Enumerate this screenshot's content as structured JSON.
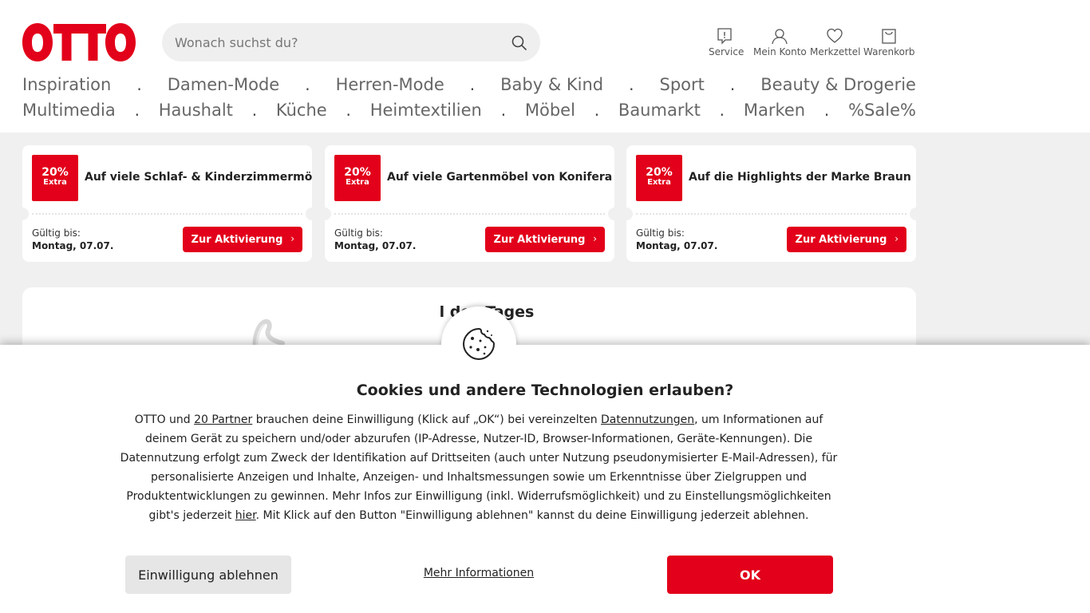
{
  "brand": {
    "logo_text": "OTTO",
    "accent_color": "#e2001a"
  },
  "search": {
    "placeholder": "Wonach suchst du?",
    "icon": "search-icon"
  },
  "header_tools": [
    {
      "label": "Service",
      "icon": "service-icon"
    },
    {
      "label": "Mein Konto",
      "icon": "user-icon"
    },
    {
      "label": "Merkzettel",
      "icon": "heart-icon"
    },
    {
      "label": "Warenkorb",
      "icon": "cart-icon"
    }
  ],
  "nav": {
    "separator": ".",
    "row1": [
      "Inspiration",
      "Damen-Mode",
      "Herren-Mode",
      "Baby & Kind",
      "Sport",
      "Beauty & Drogerie"
    ],
    "row2": [
      "Multimedia",
      "Haushalt",
      "Küche",
      "Heimtextilien",
      "Möbel",
      "Baumarkt",
      "Marken",
      "%Sale%"
    ]
  },
  "coupons": [
    {
      "badge_pct": "20%",
      "badge_extra": "Extra",
      "title": "Auf viele Schlaf- & Kinderzimmermöbel",
      "valid_label": "Gültig bis:",
      "valid_date": "Montag, 07.07.",
      "button": "Zur Aktivierung"
    },
    {
      "badge_pct": "20%",
      "badge_extra": "Extra",
      "title": "Auf viele Gartenmöbel von Konifera",
      "valid_label": "Gültig bis:",
      "valid_date": "Montag, 07.07.",
      "button": "Zur Aktivierung"
    },
    {
      "badge_pct": "20%",
      "badge_extra": "Extra",
      "title": "Auf die Highlights der Marke Braun",
      "valid_label": "Gültig bis:",
      "valid_date": "Montag, 07.07.",
      "button": "Zur Aktivierung"
    }
  ],
  "deal": {
    "title": "l des Tages"
  },
  "cookie_banner": {
    "title": "Cookies und andere Technologien erlauben?",
    "text_1": "OTTO und ",
    "link_partner": "20 Partner",
    "text_2": " brauchen deine Einwilligung (Klick auf „OK“) bei vereinzelten ",
    "link_datennutzungen": "Datennutzungen",
    "text_3": ", um Informationen auf deinem Gerät zu speichern und/oder abzurufen (IP-Adresse, Nutzer-ID, Browser-Informationen, Geräte-Kennungen). Die Datennutzung erfolgt zum Zweck der Identifikation auf Drittseiten (auch unter Nutzung pseudonymisierter E-Mail-Adressen), für personalisierte Anzeigen und Inhalte, Anzeigen- und Inhaltsmessungen sowie um Erkenntnisse über Zielgruppen und Produktentwicklungen zu gewinnen. Mehr Infos zur Einwilligung (inkl. Widerrufsmöglichkeit) und zu Einstellungsmöglichkeiten gibt's jederzeit ",
    "link_hier": "hier",
    "text_4": ". Mit Klick auf den Button \"Einwilligung ablehnen\" kannst du deine Einwilligung jederzeit ablehnen.",
    "btn_decline": "Einwilligung ablehnen",
    "link_more": "Mehr Informationen",
    "btn_ok": "OK"
  }
}
